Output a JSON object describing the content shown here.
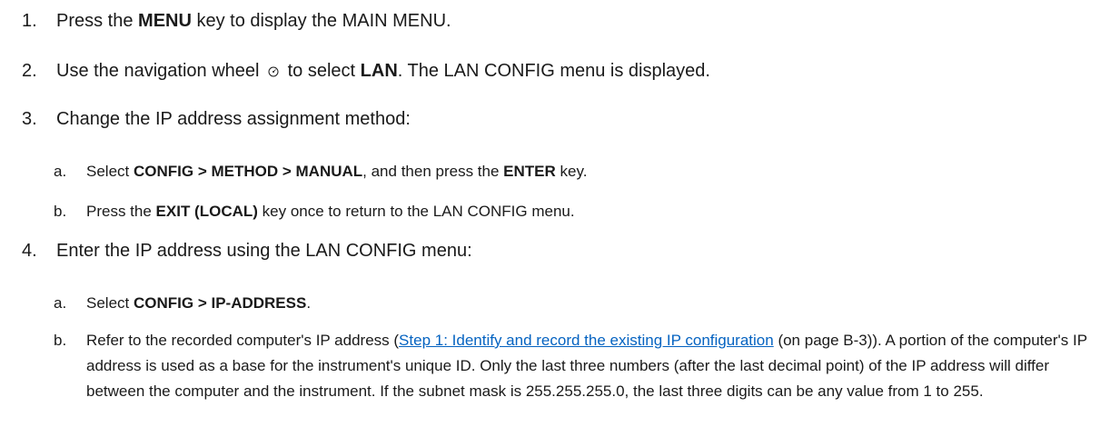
{
  "steps": [
    {
      "num": "1.",
      "pre": "Press the ",
      "key": "MENU",
      "post": " key to display the MAIN MENU."
    },
    {
      "num": "2.",
      "pre": "Use the navigation wheel ",
      "icon": "navigation-wheel-icon",
      "mid": " to select ",
      "key": "LAN",
      "post": ". The LAN CONFIG menu is displayed."
    },
    {
      "num": "3.",
      "text": "Change the IP address assignment method:",
      "substeps": [
        {
          "num": "a.",
          "pre": "Select ",
          "bold1": "CONFIG > METHOD > MANUAL",
          "mid": ", and then press the ",
          "bold2": "ENTER",
          "post": " key."
        },
        {
          "num": "b.",
          "pre": "Press the ",
          "bold1": "EXIT (LOCAL)",
          "post": " key once to return to the LAN CONFIG menu."
        }
      ]
    },
    {
      "num": "4.",
      "text": "Enter the IP address using the LAN CONFIG menu:",
      "substeps": [
        {
          "num": "a.",
          "pre": "Select ",
          "bold1": "CONFIG > IP-ADDRESS",
          "post": "."
        },
        {
          "num": "b.",
          "pre": "Refer to the recorded computer's IP address (",
          "link": "Step 1: Identify and record the existing IP configuration",
          "post": " (on page B-3)). A portion of the computer's IP address is used as a base for the instrument's unique ID. Only the last three numbers (after the last decimal point) of the IP address will differ between the computer and the instrument. If the subnet mask is 255.255.255.0, the last three digits can be any value from 1 to 255."
        }
      ]
    }
  ],
  "colors": {
    "text": "#1a1a1a",
    "link": "#0563c1"
  }
}
